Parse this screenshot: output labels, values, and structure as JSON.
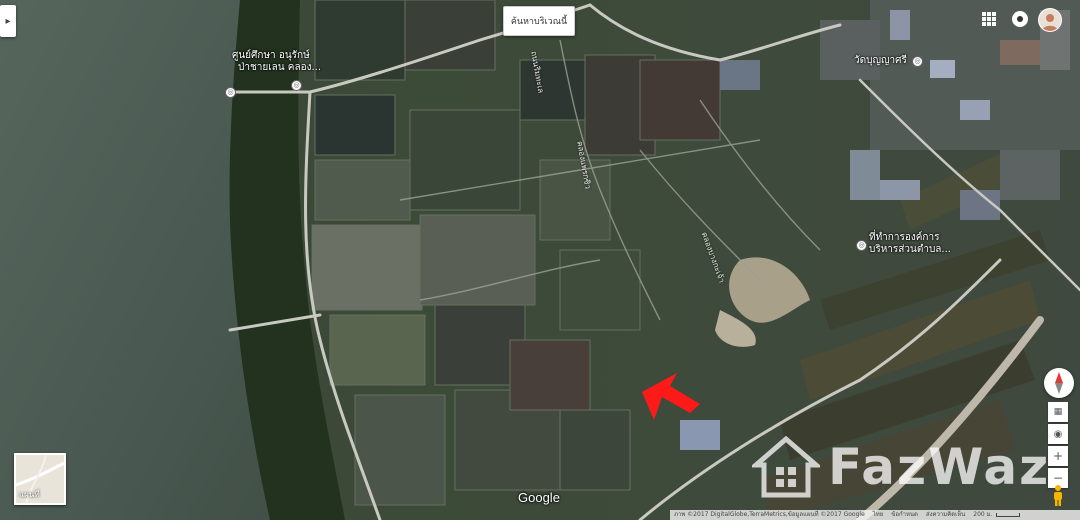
{
  "map": {
    "type": "satellite",
    "accent_colors": {
      "marker": "#ff1a1a",
      "road": "#c9c9c1",
      "water": "#4a5b53"
    },
    "search_area_button": "ค้นหาบริเวณนี้",
    "side_toggle_glyph": "▸",
    "labels": {
      "poi_park_line1": "ศูนย์ศึกษา อนุรักษ์",
      "poi_park_line2": "ป่าชายเลน คลอง...",
      "poi_temple": "วัดบุญญาศรี",
      "poi_office_line1": "ที่ทำการองค์การ",
      "poi_office_line2": "บริหารส่วนตำบล...",
      "road_1": "ถนนริมทะเล",
      "road_2": "คลองแพรกซิว",
      "road_3": "คลองบางกะเจ้า"
    },
    "layer_toggle_label": "แผนที่",
    "google_logo": "Google",
    "attribution": {
      "imagery": "ภาพ ©2017 DigitalGlobe,TerraMetrics,ข้อมูลแผนที่ ©2017 Google",
      "country": "ไทย",
      "terms": "ข้อกำหนด",
      "feedback": "ส่งความคิดเห็น",
      "scale": "200 ม."
    },
    "controls": {
      "zoom_in": "+",
      "zoom_out": "−"
    },
    "watermark": "FazWaz"
  }
}
